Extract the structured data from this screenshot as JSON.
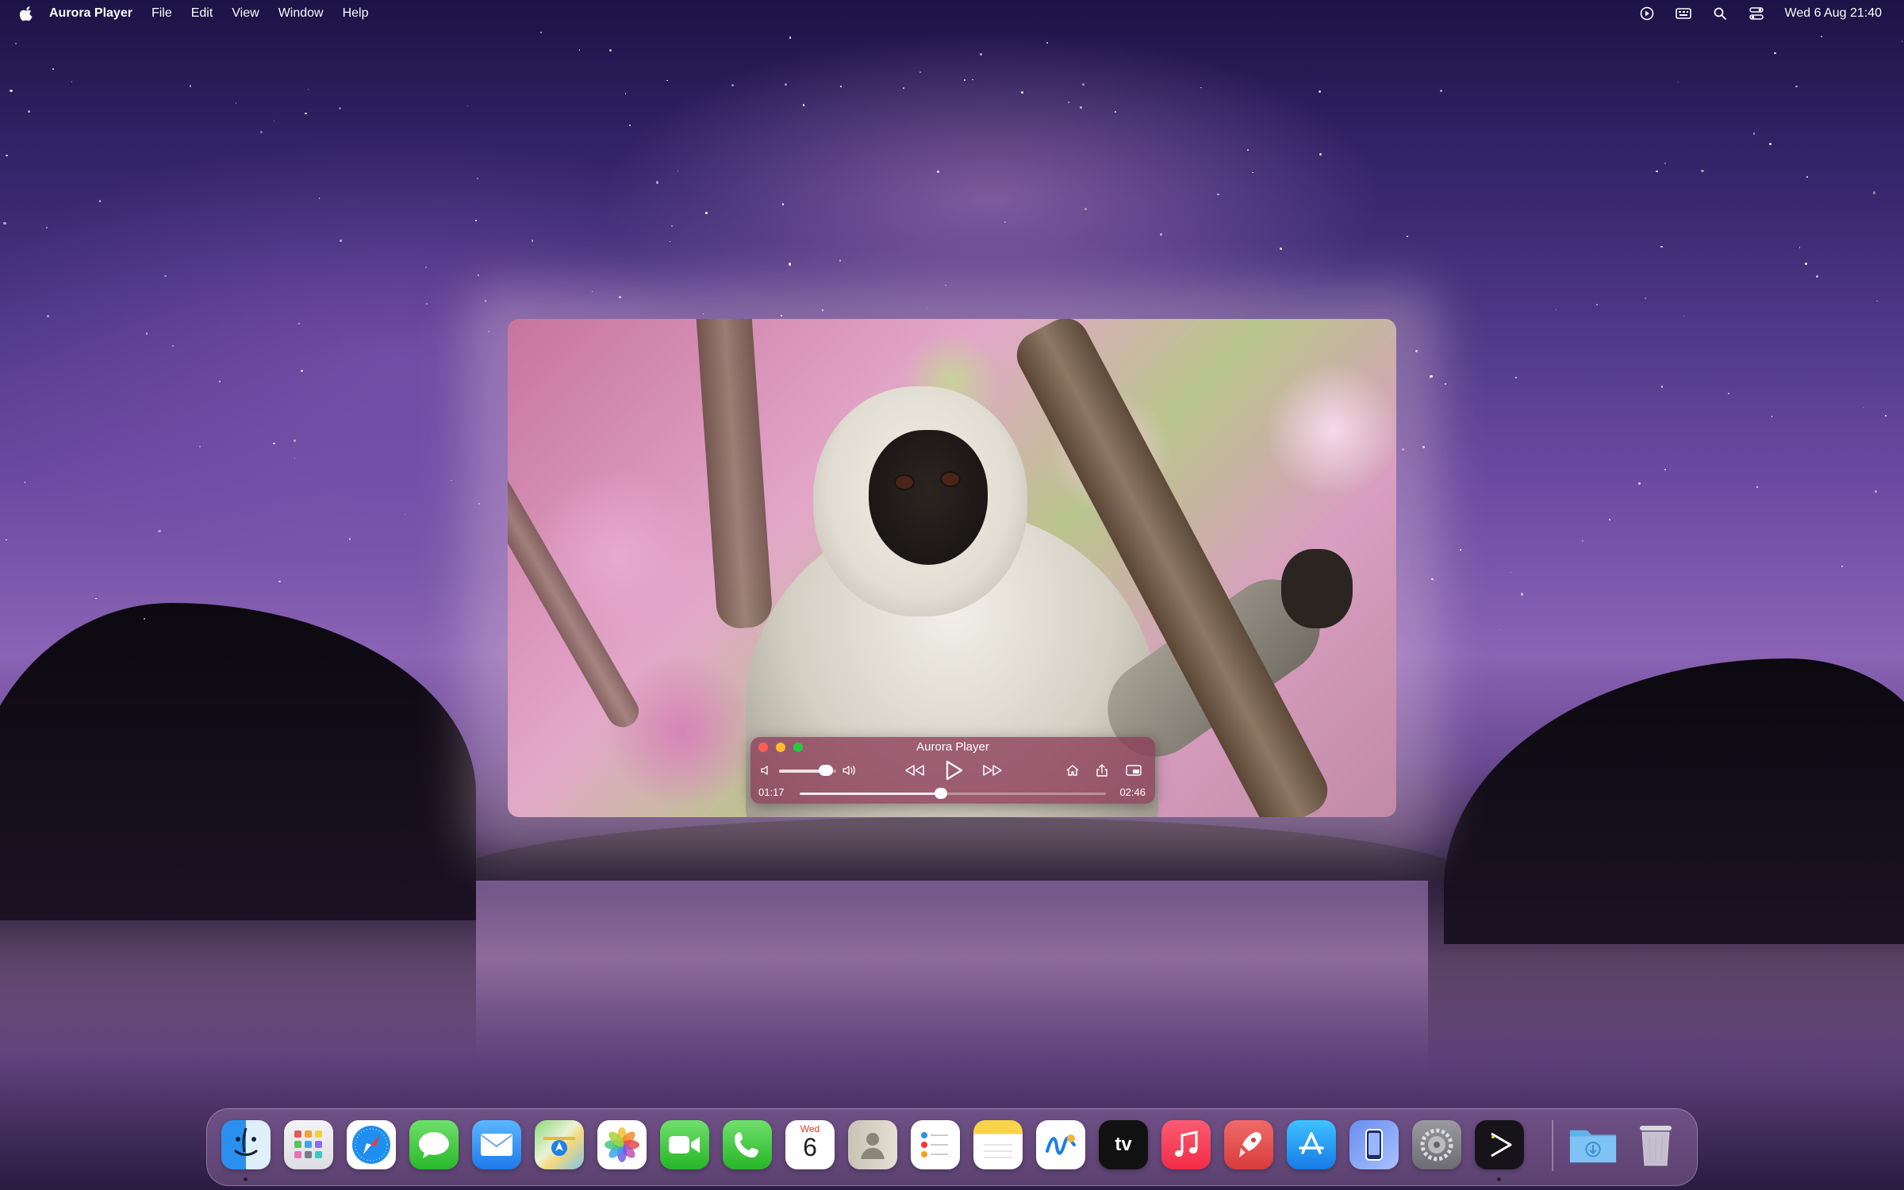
{
  "menubar": {
    "app_name": "Aurora Player",
    "menus": [
      "File",
      "Edit",
      "View",
      "Window",
      "Help"
    ],
    "status_icons": [
      "play-circle-icon",
      "keyboard-icon",
      "search-icon",
      "control-center-icon"
    ],
    "clock": "Wed 6 Aug 21:40"
  },
  "player": {
    "title": "Aurora Player",
    "elapsed": "01:17",
    "duration": "02:46",
    "playback_progress": 0.46,
    "volume_level": 0.75,
    "state": "paused"
  },
  "dock": {
    "apps": [
      "Finder",
      "Launchpad",
      "Safari",
      "Messages",
      "Mail",
      "Maps",
      "Photos",
      "FaceTime",
      "Phone",
      "Calendar",
      "Contacts",
      "Reminders",
      "Notes",
      "Freeform",
      "TV",
      "Music",
      "Rocket",
      "App Store",
      "iPhone Mirroring",
      "System Settings",
      "Aurora Player"
    ],
    "calendar_weekday": "Wed",
    "calendar_day": "6",
    "tv_label": "tv",
    "folders": [
      "Downloads",
      "Trash"
    ]
  },
  "colors": {
    "controls_bg": "#8c3c5a",
    "close": "#ff5f57",
    "minimize": "#febc2e",
    "zoom": "#28c840"
  }
}
